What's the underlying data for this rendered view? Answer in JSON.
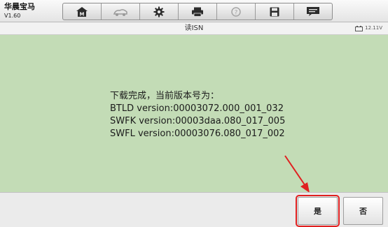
{
  "app": {
    "title": "华晨宝马",
    "version": "V1.60"
  },
  "toolbar": {
    "icons": [
      "home-icon",
      "vehicle-icon",
      "settings-gear-icon",
      "printer-icon",
      "help-icon",
      "save-icon",
      "message-icon"
    ]
  },
  "header": {
    "title": "读ISN",
    "battery_voltage": "12.11V"
  },
  "message": {
    "lines": [
      "下载完成，当前版本号为：",
      "BTLD version:00003072.000_001_032",
      "SWFK version:00003daa.080_017_005",
      "SWFL version:00003076.080_017_002"
    ]
  },
  "buttons": {
    "yes_label": "是",
    "no_label": "否"
  },
  "colors": {
    "content_bg": "#c3dcb6",
    "highlight": "#e02020"
  }
}
